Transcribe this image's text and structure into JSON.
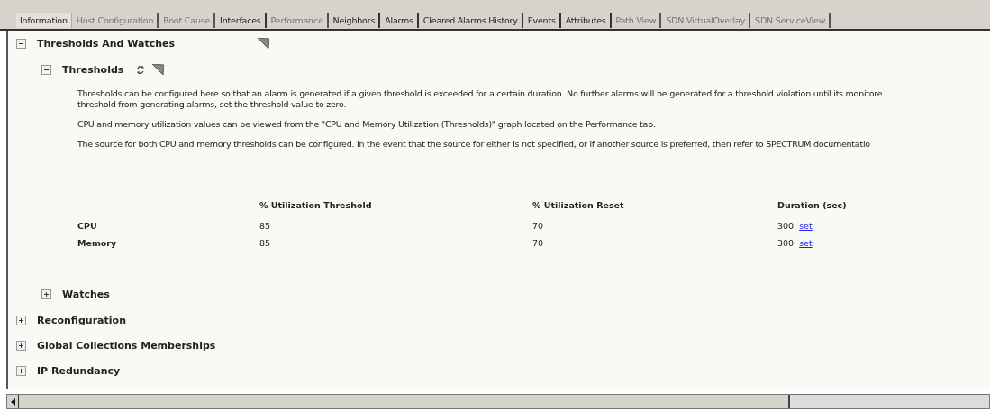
{
  "tabs": [
    {
      "label": "Information",
      "selected": true,
      "disabled": false
    },
    {
      "label": "Host Configuration",
      "selected": false,
      "disabled": true
    },
    {
      "label": "Root Cause",
      "selected": false,
      "disabled": true
    },
    {
      "label": "Interfaces",
      "selected": false,
      "disabled": false
    },
    {
      "label": "Performance",
      "selected": false,
      "disabled": true
    },
    {
      "label": "Neighbors",
      "selected": false,
      "disabled": false
    },
    {
      "label": "Alarms",
      "selected": false,
      "disabled": false
    },
    {
      "label": "Cleared Alarms History",
      "selected": false,
      "disabled": false
    },
    {
      "label": "Events",
      "selected": false,
      "disabled": false
    },
    {
      "label": "Attributes",
      "selected": false,
      "disabled": false
    },
    {
      "label": "Path View",
      "selected": false,
      "disabled": true
    },
    {
      "label": "SDN VirtualOverlay",
      "selected": false,
      "disabled": true
    },
    {
      "label": "SDN ServiceView",
      "selected": false,
      "disabled": true
    }
  ],
  "tree": [
    {
      "title": "Thresholds And Watches",
      "expanded": true,
      "children": [
        {
          "title": "Thresholds",
          "expanded": true,
          "paragraphs": [
            [
              "Thresholds can be configured here so that an alarm is generated if a given threshold is exceeded for a certain duration. No further alarms will be generated for a threshold violation until its monitore",
              "threshold from generating alarms, set the threshold value to zero."
            ],
            [
              "CPU and memory utilization values can be viewed from the \"CPU and Memory Utilization (Thresholds)\" graph located on the Performance tab."
            ],
            [
              "The source for both CPU and memory thresholds can be configured. In the event that the source for either is not specified, or if another source is preferred, then refer to SPECTRUM documentatio"
            ]
          ],
          "table": {
            "columns": [
              "% Utilization Threshold",
              "% Utilization Reset",
              "Duration (sec)"
            ],
            "rows": [
              {
                "label": "CPU",
                "threshold": "85",
                "reset": "70",
                "duration": "300",
                "link": "set"
              },
              {
                "label": "Memory",
                "threshold": "85",
                "reset": "70",
                "duration": "300",
                "link": "set"
              }
            ]
          }
        },
        {
          "title": "Watches",
          "expanded": false
        }
      ]
    },
    {
      "title": "Reconfiguration",
      "expanded": false
    },
    {
      "title": "Global Collections Memberships",
      "expanded": false
    },
    {
      "title": "IP Redundancy",
      "expanded": false
    }
  ]
}
